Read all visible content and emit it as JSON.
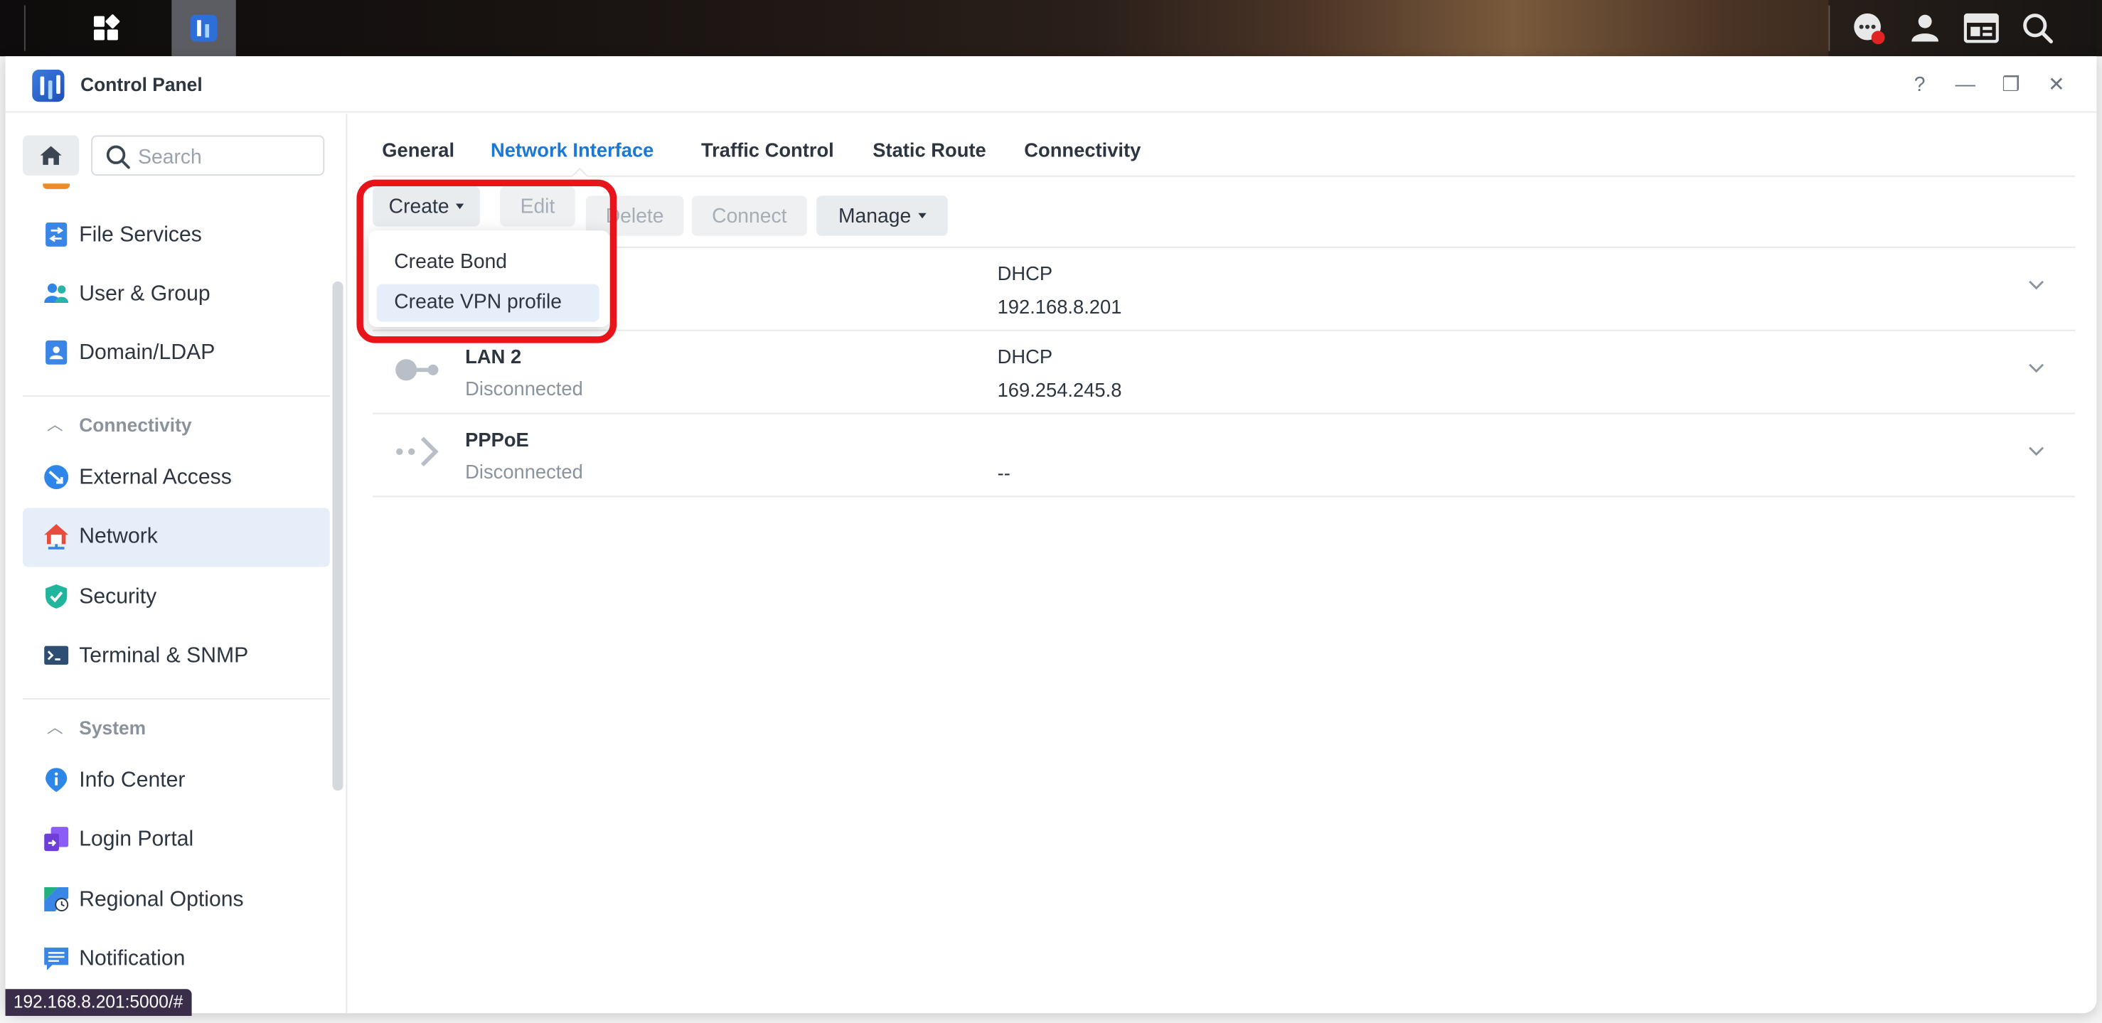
{
  "window": {
    "title": "Control Panel",
    "controls": [
      "?",
      "—",
      "❐",
      "✕"
    ]
  },
  "sidebar": {
    "search_placeholder": "Search",
    "items_top": [
      {
        "label": "File Services",
        "icon": "file-services-icon"
      },
      {
        "label": "User & Group",
        "icon": "user-group-icon"
      },
      {
        "label": "Domain/LDAP",
        "icon": "domain-ldap-icon"
      }
    ],
    "section_connectivity": "Connectivity",
    "items_connectivity": [
      {
        "label": "External Access",
        "icon": "external-access-icon"
      },
      {
        "label": "Network",
        "icon": "network-icon",
        "active": true
      },
      {
        "label": "Security",
        "icon": "security-icon"
      },
      {
        "label": "Terminal & SNMP",
        "icon": "terminal-icon"
      }
    ],
    "section_system": "System",
    "items_system": [
      {
        "label": "Info Center",
        "icon": "info-center-icon"
      },
      {
        "label": "Login Portal",
        "icon": "login-portal-icon"
      },
      {
        "label": "Regional Options",
        "icon": "regional-options-icon"
      },
      {
        "label": "Notification",
        "icon": "notification-icon"
      }
    ]
  },
  "tabs": [
    "General",
    "Network Interface",
    "Traffic Control",
    "Static Route",
    "Connectivity"
  ],
  "active_tab": "Network Interface",
  "toolbar": {
    "create": "Create",
    "edit": "Edit",
    "delete": "Delete",
    "connect": "Connect",
    "manage": "Manage"
  },
  "dropdown": {
    "items": [
      "Create Bond",
      "Create VPN profile"
    ]
  },
  "interfaces": [
    {
      "name": "",
      "status": "",
      "mode": "DHCP",
      "ip": "192.168.8.201"
    },
    {
      "name": "LAN 2",
      "status": "Disconnected",
      "mode": "DHCP",
      "ip": "169.254.245.8"
    },
    {
      "name": "PPPoE",
      "status": "Disconnected",
      "mode": "",
      "ip": "--"
    }
  ],
  "status_url": "192.168.8.201:5000/#",
  "colors": {
    "accent": "#1a78d6",
    "highlight": "#e8141c",
    "active_bg": "#e6eef9"
  }
}
